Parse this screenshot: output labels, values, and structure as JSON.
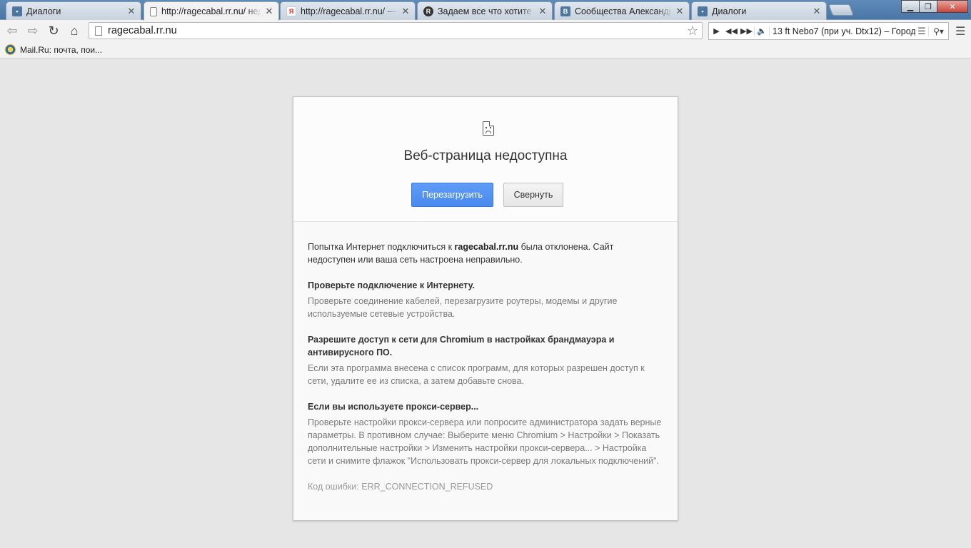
{
  "tabs": [
    {
      "title": "Диалоги",
      "favicon": "vk-dialog-icon",
      "color": "#4d76a1"
    },
    {
      "title": "http://ragecabal.rr.nu/ недоступна",
      "favicon": "page-icon",
      "active": true
    },
    {
      "title": "http://ragecabal.rr.nu/ — Яндекс",
      "favicon": "yandex-icon",
      "color": "#e22"
    },
    {
      "title": "Задаем все что хотите знать",
      "favicon": "r-icon",
      "color": "#333"
    },
    {
      "title": "Сообщества Александра",
      "favicon": "vk-icon",
      "color": "#4d76a1"
    },
    {
      "title": "Диалоги",
      "favicon": "vk-dialog-icon",
      "color": "#4d76a1"
    }
  ],
  "window": {
    "minimize": "▁",
    "maximize": "❐",
    "close": "✕"
  },
  "toolbar": {
    "url": "ragecabal.rr.nu",
    "player_track": "13 ft Nebo7 (при уч. Dtx12) – Город"
  },
  "bookmarks": [
    {
      "label": "Mail.Ru: почта, пои..."
    }
  ],
  "error": {
    "title": "Веб-страница недоступна",
    "reload_label": "Перезагрузить",
    "collapse_label": "Свернуть",
    "lead_prefix": "Попытка Интернет подключиться к ",
    "lead_host": "ragecabal.rr.nu",
    "lead_suffix": " была отклонена. Сайт недоступен или ваша сеть настроена неправильно.",
    "sections": [
      {
        "heading": "Проверьте подключение к Интернету.",
        "text": "Проверьте соединение кабелей, перезагрузите роутеры, модемы и другие используемые сетевые устройства."
      },
      {
        "heading": "Разрешите доступ к сети для Chromium в настройках брандмауэра и антивирусного ПО.",
        "text": "Если эта программа внесена с список программ, для которых разрешен доступ к сети, удалите ее из списка, а затем добавьте снова."
      },
      {
        "heading": "Если вы используете прокси-сервер...",
        "text": "Проверьте настройки прокси-сервера или попросите администратора задать верные параметры. В противном случае: Выберите меню Chromium > Настройки > Показать дополнительные настройки > Изменить настройки прокси-сервера... > Настройка сети и снимите флажок \"Использовать прокси-сервер для локальных подключений\"."
      }
    ],
    "error_code": "Код ошибки: ERR_CONNECTION_REFUSED"
  }
}
